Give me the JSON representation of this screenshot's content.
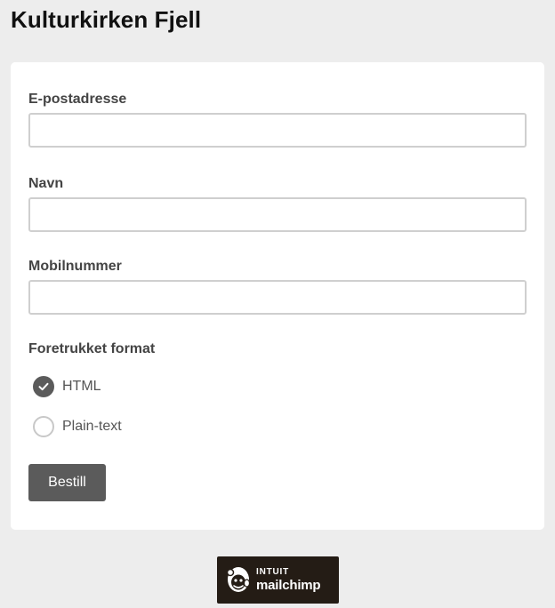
{
  "page": {
    "title": "Kulturkirken Fjell"
  },
  "form": {
    "fields": [
      {
        "label": "E-postadresse",
        "value": "",
        "placeholder": ""
      },
      {
        "label": "Navn",
        "value": "",
        "placeholder": ""
      },
      {
        "label": "Mobilnummer",
        "value": "",
        "placeholder": ""
      }
    ],
    "format": {
      "label": "Foretrukket format",
      "options": [
        {
          "label": "HTML",
          "selected": true
        },
        {
          "label": "Plain-text",
          "selected": false
        }
      ]
    },
    "submit_label": "Bestill"
  },
  "footer": {
    "badge_top": "INTUIT",
    "badge_brand": "mailchimp",
    "badge_icon": "mailchimp-freddie-icon"
  },
  "colors": {
    "background": "#ededed",
    "card": "#ffffff",
    "button": "#5b5b5b",
    "badge": "#241c15"
  }
}
